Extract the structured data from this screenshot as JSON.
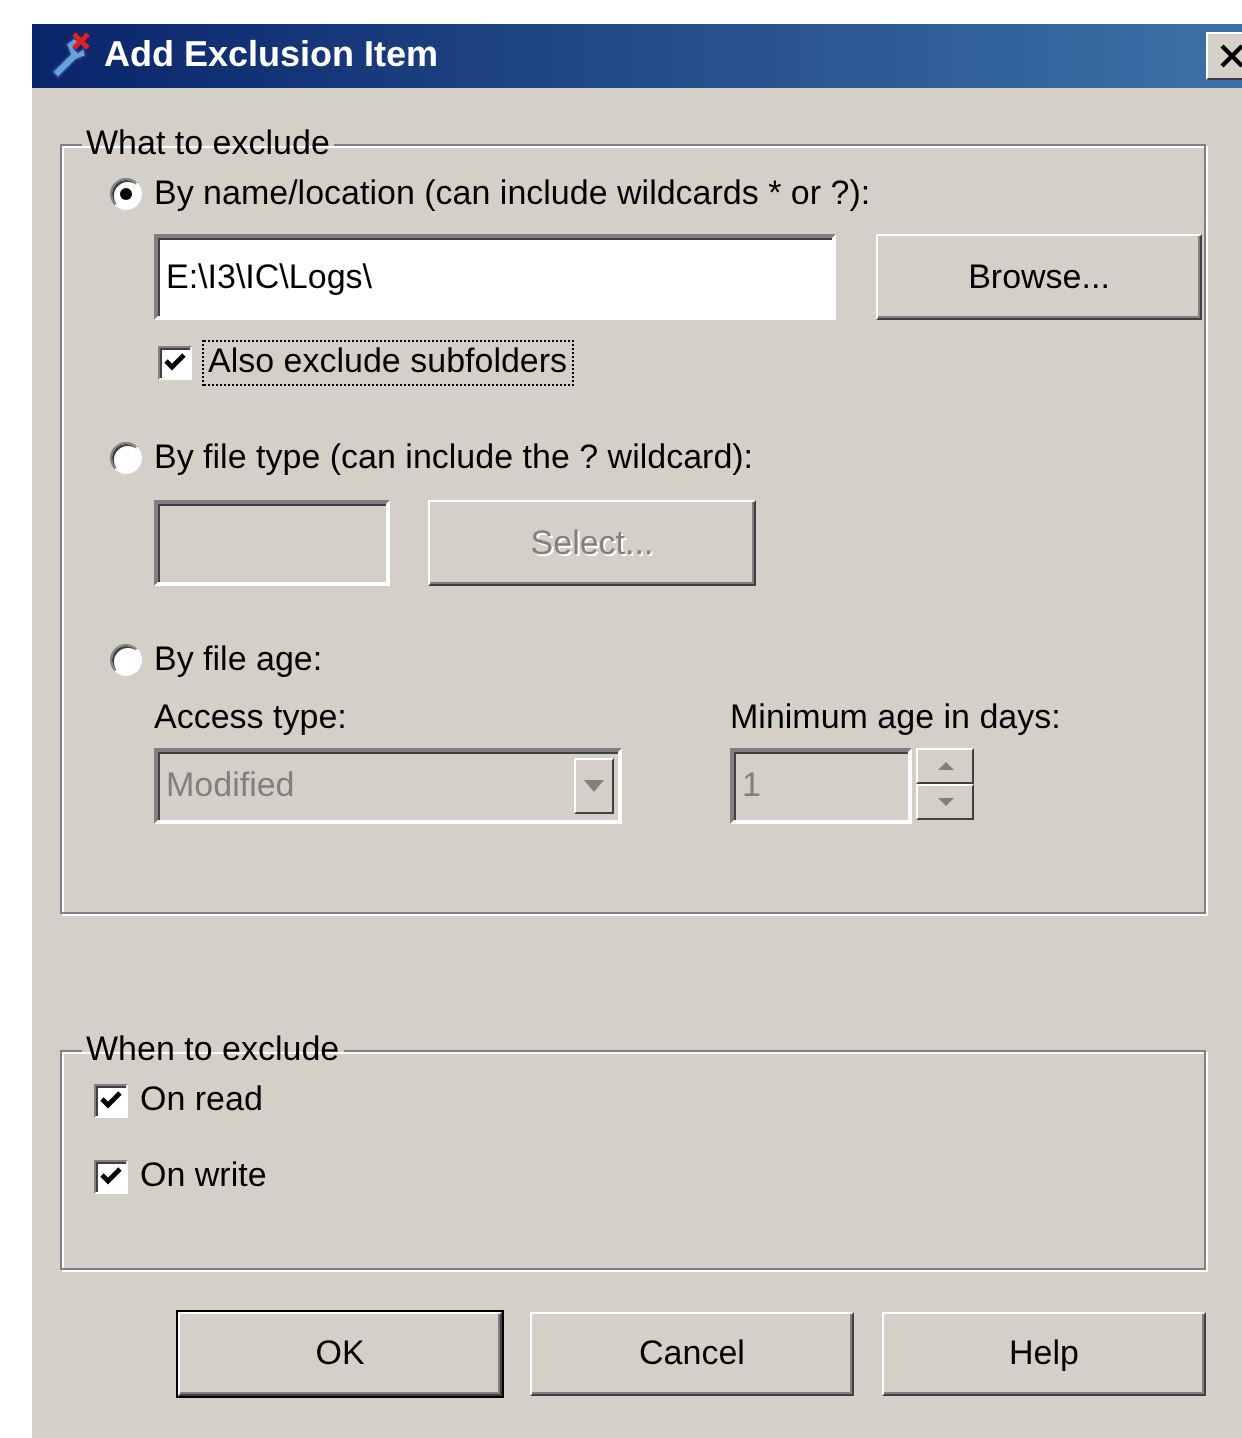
{
  "window": {
    "title": "Add Exclusion Item"
  },
  "what_to_exclude": {
    "title": "What to exclude",
    "by_name": {
      "label": "By name/location (can include wildcards * or ?):",
      "selected": true,
      "path": {
        "value": "E:\\I3\\IC\\Logs\\",
        "disabled": false
      },
      "browse_button": {
        "label": "Browse...",
        "disabled": false
      },
      "subfolders": {
        "label": "Also exclude subfolders",
        "checked": true,
        "focused": true
      }
    },
    "by_file_type": {
      "label": "By file type (can include the ? wildcard):",
      "selected": false,
      "type_field": {
        "disabled": true
      },
      "select_button": {
        "label": "Select...",
        "disabled": true
      }
    },
    "by_file_age": {
      "label": "By file age:",
      "selected": false,
      "access_type": {
        "label": "Access type:",
        "value": "Modified",
        "disabled": true
      },
      "minimum_age": {
        "label": "Minimum age in days:",
        "value": "1",
        "disabled": true
      }
    }
  },
  "when_to_exclude": {
    "title": "When to exclude",
    "options": [
      {
        "label": "On read",
        "checked": true
      },
      {
        "label": "On write",
        "checked": true
      }
    ]
  },
  "buttons": [
    {
      "label": "OK",
      "default": true
    },
    {
      "label": "Cancel",
      "default": false
    },
    {
      "label": "Help",
      "default": false
    }
  ]
}
